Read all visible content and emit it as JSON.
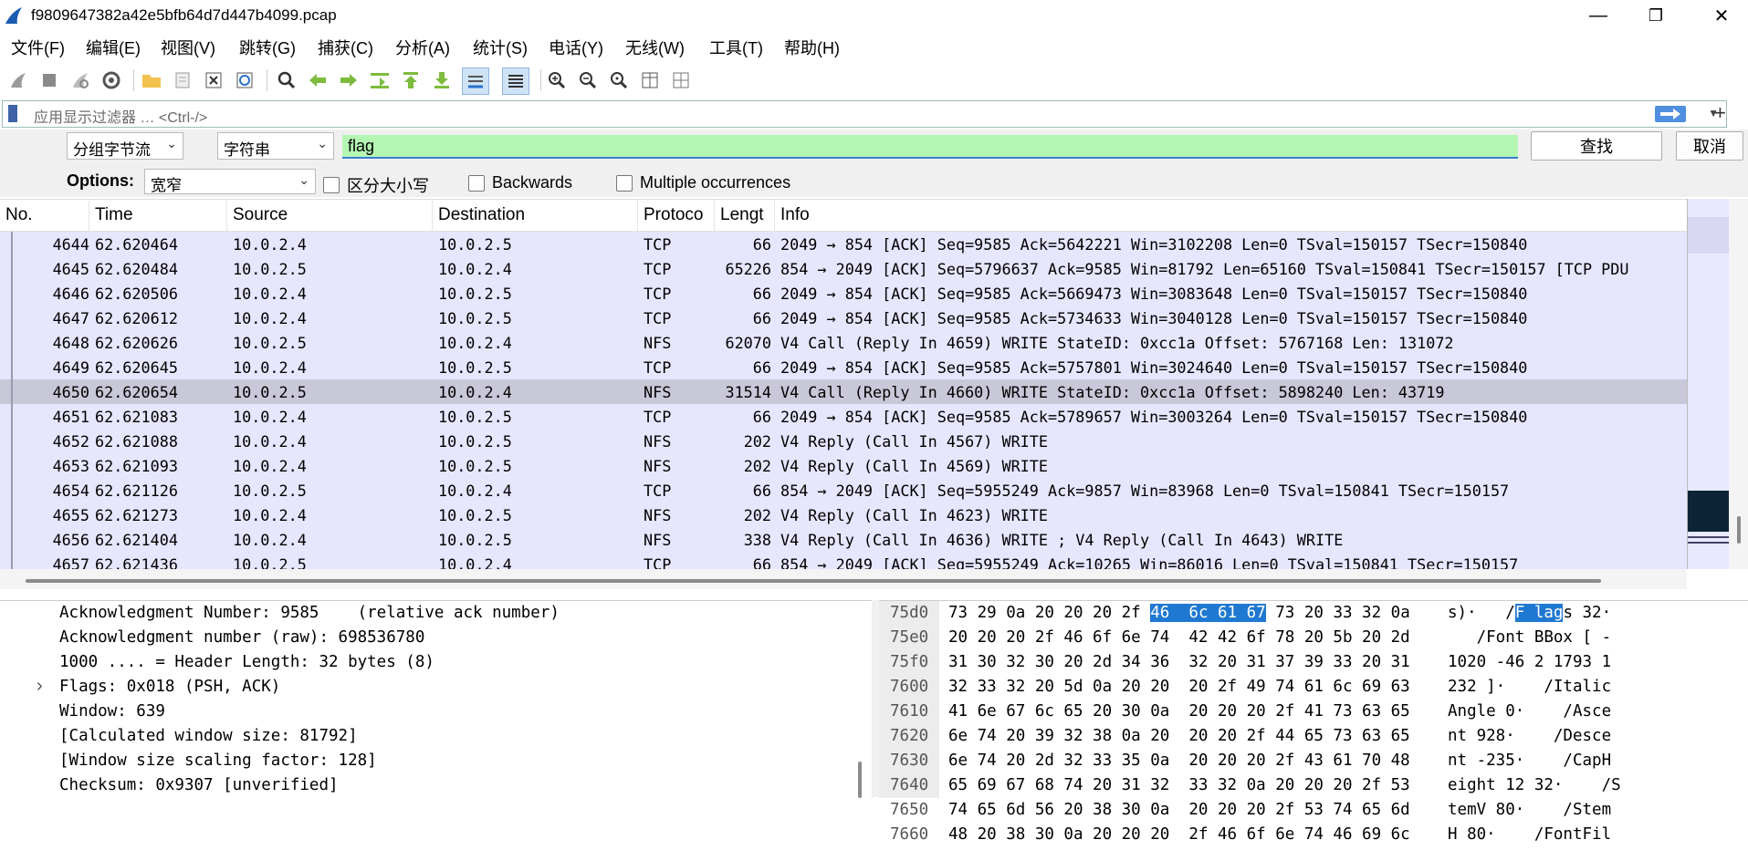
{
  "window": {
    "title": "f9809647382a42e5bfb64d7d447b4099.pcap",
    "minimize": "—",
    "maximize": "❐",
    "close": "✕"
  },
  "menu": [
    "文件(F)",
    "编辑(E)",
    "视图(V)",
    "跳转(G)",
    "捕获(C)",
    "分析(A)",
    "统计(S)",
    "电话(Y)",
    "无线(W)",
    "工具(T)",
    "帮助(H)"
  ],
  "filter": {
    "placeholder": "应用显示过滤器 … <Ctrl-/>",
    "add": "+"
  },
  "find": {
    "search_in": "分组字节流",
    "search_type": "字符串",
    "query": "flag",
    "find_button": "查找",
    "cancel_button": "取消",
    "options_label": "Options:",
    "charset": "宽窄",
    "case_sensitive": "区分大小写",
    "backwards": "Backwards",
    "multiple": "Multiple occurrences"
  },
  "columns": [
    "No.",
    "Time",
    "Source",
    "Destination",
    "Protoco",
    "Lengt",
    "Info"
  ],
  "packets": [
    {
      "no": "4644",
      "time": "62.620464",
      "src": "10.0.2.4",
      "dst": "10.0.2.5",
      "proto": "TCP",
      "len": "66",
      "info": "2049 → 854 [ACK] Seq=9585 Ack=5642221 Win=3102208 Len=0 TSval=150157 TSecr=150840"
    },
    {
      "no": "4645",
      "time": "62.620484",
      "src": "10.0.2.5",
      "dst": "10.0.2.4",
      "proto": "TCP",
      "len": "65226",
      "info": "854 → 2049 [ACK] Seq=5796637 Ack=9585 Win=81792 Len=65160 TSval=150841 TSecr=150157 [TCP PDU"
    },
    {
      "no": "4646",
      "time": "62.620506",
      "src": "10.0.2.4",
      "dst": "10.0.2.5",
      "proto": "TCP",
      "len": "66",
      "info": "2049 → 854 [ACK] Seq=9585 Ack=5669473 Win=3083648 Len=0 TSval=150157 TSecr=150840"
    },
    {
      "no": "4647",
      "time": "62.620612",
      "src": "10.0.2.4",
      "dst": "10.0.2.5",
      "proto": "TCP",
      "len": "66",
      "info": "2049 → 854 [ACK] Seq=9585 Ack=5734633 Win=3040128 Len=0 TSval=150157 TSecr=150840"
    },
    {
      "no": "4648",
      "time": "62.620626",
      "src": "10.0.2.5",
      "dst": "10.0.2.4",
      "proto": "NFS",
      "len": "62070",
      "info": "V4 Call (Reply In 4659) WRITE StateID: 0xcc1a Offset: 5767168 Len: 131072"
    },
    {
      "no": "4649",
      "time": "62.620645",
      "src": "10.0.2.4",
      "dst": "10.0.2.5",
      "proto": "TCP",
      "len": "66",
      "info": "2049 → 854 [ACK] Seq=9585 Ack=5757801 Win=3024640 Len=0 TSval=150157 TSecr=150840"
    },
    {
      "no": "4650",
      "time": "62.620654",
      "src": "10.0.2.5",
      "dst": "10.0.2.4",
      "proto": "NFS",
      "len": "31514",
      "info": "V4 Call (Reply In 4660) WRITE StateID: 0xcc1a Offset: 5898240 Len: 43719"
    },
    {
      "no": "4651",
      "time": "62.621083",
      "src": "10.0.2.4",
      "dst": "10.0.2.5",
      "proto": "TCP",
      "len": "66",
      "info": "2049 → 854 [ACK] Seq=9585 Ack=5789657 Win=3003264 Len=0 TSval=150157 TSecr=150840"
    },
    {
      "no": "4652",
      "time": "62.621088",
      "src": "10.0.2.4",
      "dst": "10.0.2.5",
      "proto": "NFS",
      "len": "202",
      "info": "V4 Reply (Call In 4567) WRITE"
    },
    {
      "no": "4653",
      "time": "62.621093",
      "src": "10.0.2.4",
      "dst": "10.0.2.5",
      "proto": "NFS",
      "len": "202",
      "info": "V4 Reply (Call In 4569) WRITE"
    },
    {
      "no": "4654",
      "time": "62.621126",
      "src": "10.0.2.5",
      "dst": "10.0.2.4",
      "proto": "TCP",
      "len": "66",
      "info": "854 → 2049 [ACK] Seq=5955249 Ack=9857 Win=83968 Len=0 TSval=150841 TSecr=150157"
    },
    {
      "no": "4655",
      "time": "62.621273",
      "src": "10.0.2.4",
      "dst": "10.0.2.5",
      "proto": "NFS",
      "len": "202",
      "info": "V4 Reply (Call In 4623) WRITE"
    },
    {
      "no": "4656",
      "time": "62.621404",
      "src": "10.0.2.4",
      "dst": "10.0.2.5",
      "proto": "NFS",
      "len": "338",
      "info": "V4 Reply (Call In 4636) WRITE  ; V4 Reply (Call In 4643) WRITE"
    },
    {
      "no": "4657",
      "time": "62.621436",
      "src": "10.0.2.5",
      "dst": "10.0.2.4",
      "proto": "TCP",
      "len": "66",
      "info": "854 → 2049 [ACK] Seq=5955249 Ack=10265 Win=86016 Len=0 TSval=150841 TSecr=150157"
    }
  ],
  "selected_packet": "4650",
  "details": [
    "Acknowledgment Number: 9585    (relative ack number)",
    "Acknowledgment number (raw): 698536780",
    "1000 .... = Header Length: 32 bytes (8)",
    "Flags: 0x018 (PSH, ACK)",
    "Window: 639",
    "[Calculated window size: 81792]",
    "[Window size scaling factor: 128]",
    "Checksum: 0x9307 [unverified]"
  ],
  "details_expander": "›",
  "bytes": [
    {
      "off": "75d0",
      "hex_a": "73 29 0a 20 20 20 2f ",
      "hex_hl": "46  6c 61 67",
      "hex_b": " 73 20 33 32 0a",
      "asc_a": "s)·   /",
      "asc_hl": "F lag",
      "asc_b": "s 32·"
    },
    {
      "off": "75e0",
      "hex_a": "20 20 20 2f 46 6f 6e 74  42 42 6f 78 20 5b 20 2d",
      "hex_hl": "",
      "hex_b": "",
      "asc_a": "   /Font BBox [ -",
      "asc_hl": "",
      "asc_b": ""
    },
    {
      "off": "75f0",
      "hex_a": "31 30 32 30 20 2d 34 36  32 20 31 37 39 33 20 31",
      "hex_hl": "",
      "hex_b": "",
      "asc_a": "1020 -46 2 1793 1",
      "asc_hl": "",
      "asc_b": ""
    },
    {
      "off": "7600",
      "hex_a": "32 33 32 20 5d 0a 20 20  20 2f 49 74 61 6c 69 63",
      "hex_hl": "",
      "hex_b": "",
      "asc_a": "232 ]·    /Italic",
      "asc_hl": "",
      "asc_b": ""
    },
    {
      "off": "7610",
      "hex_a": "41 6e 67 6c 65 20 30 0a  20 20 20 2f 41 73 63 65",
      "hex_hl": "",
      "hex_b": "",
      "asc_a": "Angle 0·    /Asce",
      "asc_hl": "",
      "asc_b": ""
    },
    {
      "off": "7620",
      "hex_a": "6e 74 20 39 32 38 0a 20  20 20 2f 44 65 73 63 65",
      "hex_hl": "",
      "hex_b": "",
      "asc_a": "nt 928·    /Desce",
      "asc_hl": "",
      "asc_b": ""
    },
    {
      "off": "7630",
      "hex_a": "6e 74 20 2d 32 33 35 0a  20 20 20 2f 43 61 70 48",
      "hex_hl": "",
      "hex_b": "",
      "asc_a": "nt -235·    /CapH",
      "asc_hl": "",
      "asc_b": ""
    },
    {
      "off": "7640",
      "hex_a": "65 69 67 68 74 20 31 32  33 32 0a 20 20 20 2f 53",
      "hex_hl": "",
      "hex_b": "",
      "asc_a": "eight 12 32·    /S",
      "asc_hl": "",
      "asc_b": ""
    },
    {
      "off": "7650",
      "hex_a": "74 65 6d 56 20 38 30 0a  20 20 20 2f 53 74 65 6d",
      "hex_hl": "",
      "hex_b": "",
      "asc_a": "temV 80·    /Stem",
      "asc_hl": "",
      "asc_b": ""
    },
    {
      "off": "7660",
      "hex_a": "48 20 38 30 0a 20 20 20  2f 46 6f 6e 74 46 69 6c",
      "hex_hl": "",
      "hex_b": "",
      "asc_a": "H 80·    /FontFil",
      "asc_hl": "",
      "asc_b": ""
    }
  ],
  "colors": {
    "row_bg": "#e7e6ff",
    "row_selected": "#c9c8d9",
    "find_bg": "#b3f7b3",
    "highlight": "#1f78d1"
  }
}
